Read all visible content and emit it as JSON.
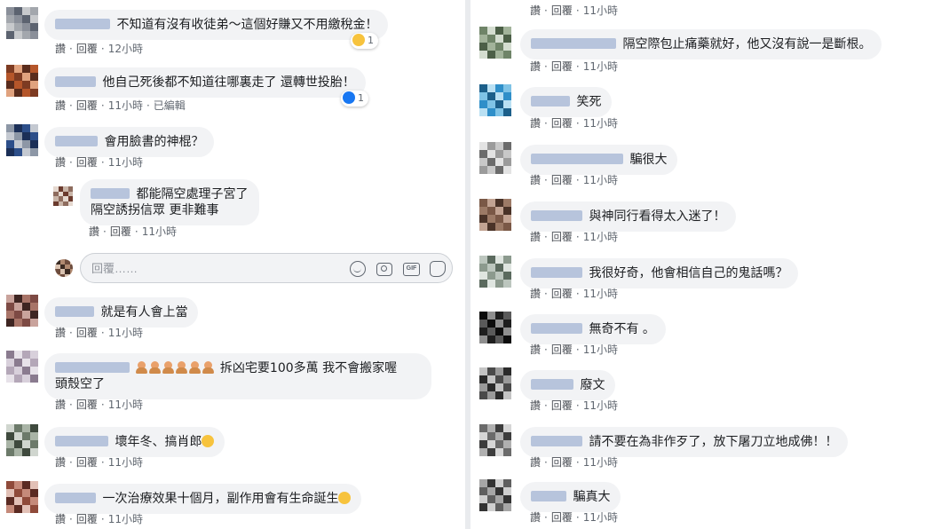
{
  "actions": {
    "like": "讚",
    "reply": "回覆",
    "edited": "已編輯"
  },
  "reply_box": {
    "placeholder": "回覆……"
  },
  "left_comments": [
    {
      "text": "不知道有沒有收徒弟～這個好賺又不用繳稅金！",
      "time": "12小時",
      "reaction_type": "haha",
      "reaction_count": "1"
    },
    {
      "text": "他自己死後都不知道往哪裏走了 還轉世投胎！",
      "time": "11小時",
      "reaction_type": "like",
      "reaction_count": "1"
    },
    {
      "text": "會用臉書的神棍？",
      "time": "11小時"
    },
    {
      "text_line1": "都能隔空處理子宮了",
      "text_line2": "隔空誘拐信眾 更非難事",
      "time": "11小時"
    },
    {
      "text": "就是有人會上當",
      "time": "11小時"
    },
    {
      "text_line1": "拆凶宅要100多萬 我不會搬家喔",
      "text_line2": "頭殼空了",
      "time": "11小時"
    },
    {
      "text": "壞年冬、搞肖郎",
      "emoji": "smirk-emoji",
      "time": "11小時"
    },
    {
      "text": "一次治療效果十個月，副作用會有生命誕生",
      "emoji": "laugh-emoji",
      "time": "11小時"
    }
  ],
  "right_comments": [
    {
      "time": "11小時"
    },
    {
      "text": "隔空際包止痛藥就好，他又沒有說一是斷根。",
      "time": "11小時"
    },
    {
      "text": "笑死",
      "time": "11小時"
    },
    {
      "text": "騙很大",
      "time": "11小時"
    },
    {
      "text": "與神同行看得太入迷了！",
      "time": "11小時"
    },
    {
      "text": "我很好奇，他會相信自己的鬼話嗎？",
      "time": "11小時"
    },
    {
      "text": "無奇不有 。",
      "time": "11小時"
    },
    {
      "text": "廢文",
      "time": "11小時"
    },
    {
      "text": "請不要在為非作歹了，放下屠刀立地成佛！！",
      "time": "11小時"
    },
    {
      "text": "騙真大",
      "time": "11小時"
    }
  ],
  "colors": {
    "bubble": "#f2f3f5",
    "link": "#4b4f56",
    "meta": "#606770",
    "divider": "#e9ebee",
    "like": "#1877f2",
    "haha": "#f7c33d"
  }
}
